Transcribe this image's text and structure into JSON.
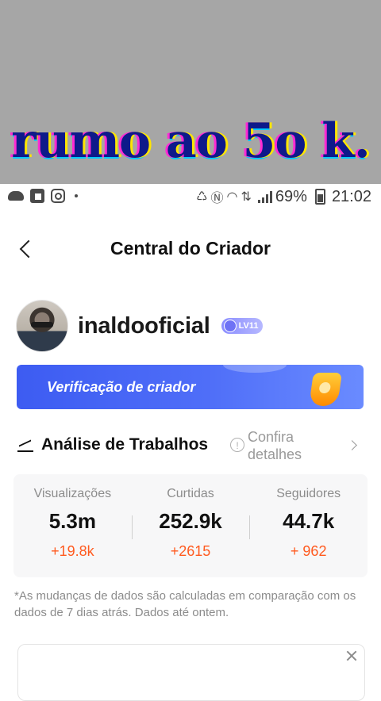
{
  "caption": {
    "text": "rumo ao 5o k."
  },
  "statusbar": {
    "battery": "69%",
    "time": "21:02"
  },
  "header": {
    "title": "Central do Criador"
  },
  "profile": {
    "username": "inaldooficial",
    "level": "LV11"
  },
  "banner": {
    "text": "Verificação de criador"
  },
  "analysis": {
    "title": "Análise de Trabalhos",
    "details_link": "Confira detalhes",
    "stats": [
      {
        "label": "Visualizações",
        "value": "5.3m",
        "delta": "+19.8k"
      },
      {
        "label": "Curtidas",
        "value": "252.9k",
        "delta": "+2615"
      },
      {
        "label": "Seguidores",
        "value": "44.7k",
        "delta": "+ 962"
      }
    ],
    "footnote": "*As mudanças de dados são calculadas em comparação com os dados de 7 dias atrás. Dados até ontem."
  },
  "card": {
    "text": ""
  },
  "colors": {
    "accent": "#4f6ef8",
    "delta": "#ff5a1f",
    "caption_band": "#a6a6a6"
  }
}
